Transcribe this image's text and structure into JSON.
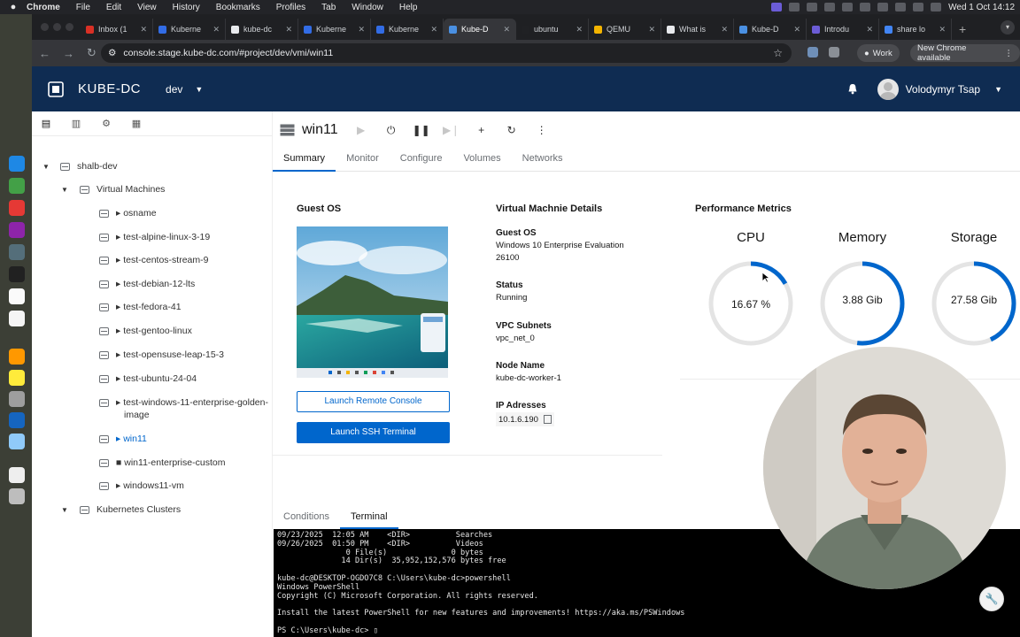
{
  "menubar": {
    "app": "Chrome",
    "items": [
      "File",
      "Edit",
      "View",
      "History",
      "Bookmarks",
      "Profiles",
      "Tab",
      "Window",
      "Help"
    ],
    "clock": "Wed 1 Oct  14:12"
  },
  "tabs": [
    {
      "label": "Inbox (1",
      "color": "#d93025"
    },
    {
      "label": "Kuberne",
      "color": "#326ce5"
    },
    {
      "label": "kube-dc",
      "color": "#e8eaed"
    },
    {
      "label": "Kuberne",
      "color": "#326ce5"
    },
    {
      "label": "Kuberne",
      "color": "#326ce5"
    },
    {
      "label": "Kube-D",
      "color": "#4a90e2"
    },
    {
      "label": "ubuntu",
      "color": "#202124"
    },
    {
      "label": "QEMU",
      "color": "#f4b400"
    },
    {
      "label": "What is",
      "color": "#e8eaed"
    },
    {
      "label": "Kube-D",
      "color": "#4a90e2"
    },
    {
      "label": "Introdu",
      "color": "#6b5cd6"
    },
    {
      "label": "share lo",
      "color": "#4285f4"
    }
  ],
  "active_tab_index": 5,
  "browser": {
    "url": "console.stage.kube-dc.com/#project/dev/vmi/win11",
    "work_label": "Work",
    "new_chrome_label": "New Chrome available"
  },
  "header": {
    "brand": "KUBE-DC",
    "project": "dev",
    "user": "Volodymyr Tsap"
  },
  "sidebar": {
    "root": "shalb-dev",
    "vm_group": "Virtual Machines",
    "vms": [
      {
        "label": "▸ osname",
        "selected": false
      },
      {
        "label": "▸ test-alpine-linux-3-19",
        "selected": false
      },
      {
        "label": "▸ test-centos-stream-9",
        "selected": false
      },
      {
        "label": "▸ test-debian-12-lts",
        "selected": false
      },
      {
        "label": "▸ test-fedora-41",
        "selected": false
      },
      {
        "label": "▸ test-gentoo-linux",
        "selected": false
      },
      {
        "label": "▸ test-opensuse-leap-15-3",
        "selected": false
      },
      {
        "label": "▸ test-ubuntu-24-04",
        "selected": false
      },
      {
        "label": "▸ test-windows-11-enterprise-golden-",
        "label2": "image",
        "selected": false
      },
      {
        "label": "▸ win11",
        "selected": true
      },
      {
        "label": "■ win11-enterprise-custom",
        "selected": false
      },
      {
        "label": "▸ windows11-vm",
        "selected": false
      }
    ],
    "k8s_group": "Kubernetes Clusters"
  },
  "vm": {
    "title": "win11",
    "tabs": [
      "Summary",
      "Monitor",
      "Configure",
      "Volumes",
      "Networks"
    ],
    "active_tab": "Summary"
  },
  "guest_os": {
    "title": "Guest OS",
    "launch_console": "Launch Remote Console",
    "launch_ssh": "Launch SSH Terminal"
  },
  "details": {
    "title": "Virtual Machnie Details",
    "guest_os_label": "Guest OS",
    "guest_os_value1": "Windows 10 Enterprise Evaluation",
    "guest_os_value2": "26100",
    "status_label": "Status",
    "status_value": "Running",
    "vpc_label": "VPC Subnets",
    "vpc_value": "vpc_net_0",
    "node_label": "Node Name",
    "node_value": "kube-dc-worker-1",
    "ip_label": "IP Adresses",
    "ip_value": "10.1.6.190"
  },
  "metrics": {
    "title": "Performance Metrics",
    "cpu": {
      "label": "CPU",
      "value": "16.67 %",
      "fraction": 0.1667
    },
    "memory": {
      "label": "Memory",
      "value": "3.88 Gib",
      "fraction": 0.52
    },
    "storage": {
      "label": "Storage",
      "value": "27.58 Gib",
      "fraction": 0.43
    }
  },
  "bottom": {
    "tabs": [
      "Conditions",
      "Terminal"
    ],
    "active_tab": "Terminal",
    "terminal_text": "09/23/2025  12:05 AM    <DIR>          Searches\n09/26/2025  01:50 PM    <DIR>          Videos\n               0 File(s)              0 bytes\n              14 Dir(s)  35,952,152,576 bytes free\n\nkube-dc@DESKTOP-OGDO7C8 C:\\Users\\kube-dc>powershell\nWindows PowerShell\nCopyright (C) Microsoft Corporation. All rights reserved.\n\nInstall the latest PowerShell for new features and improvements! https://aka.ms/PSWindows\n\nPS C:\\Users\\kube-dc> ▯"
  },
  "colors": {
    "header_bg": "#0f2c52",
    "accent": "#0066cc",
    "gauge_track": "#e4e4e4"
  }
}
